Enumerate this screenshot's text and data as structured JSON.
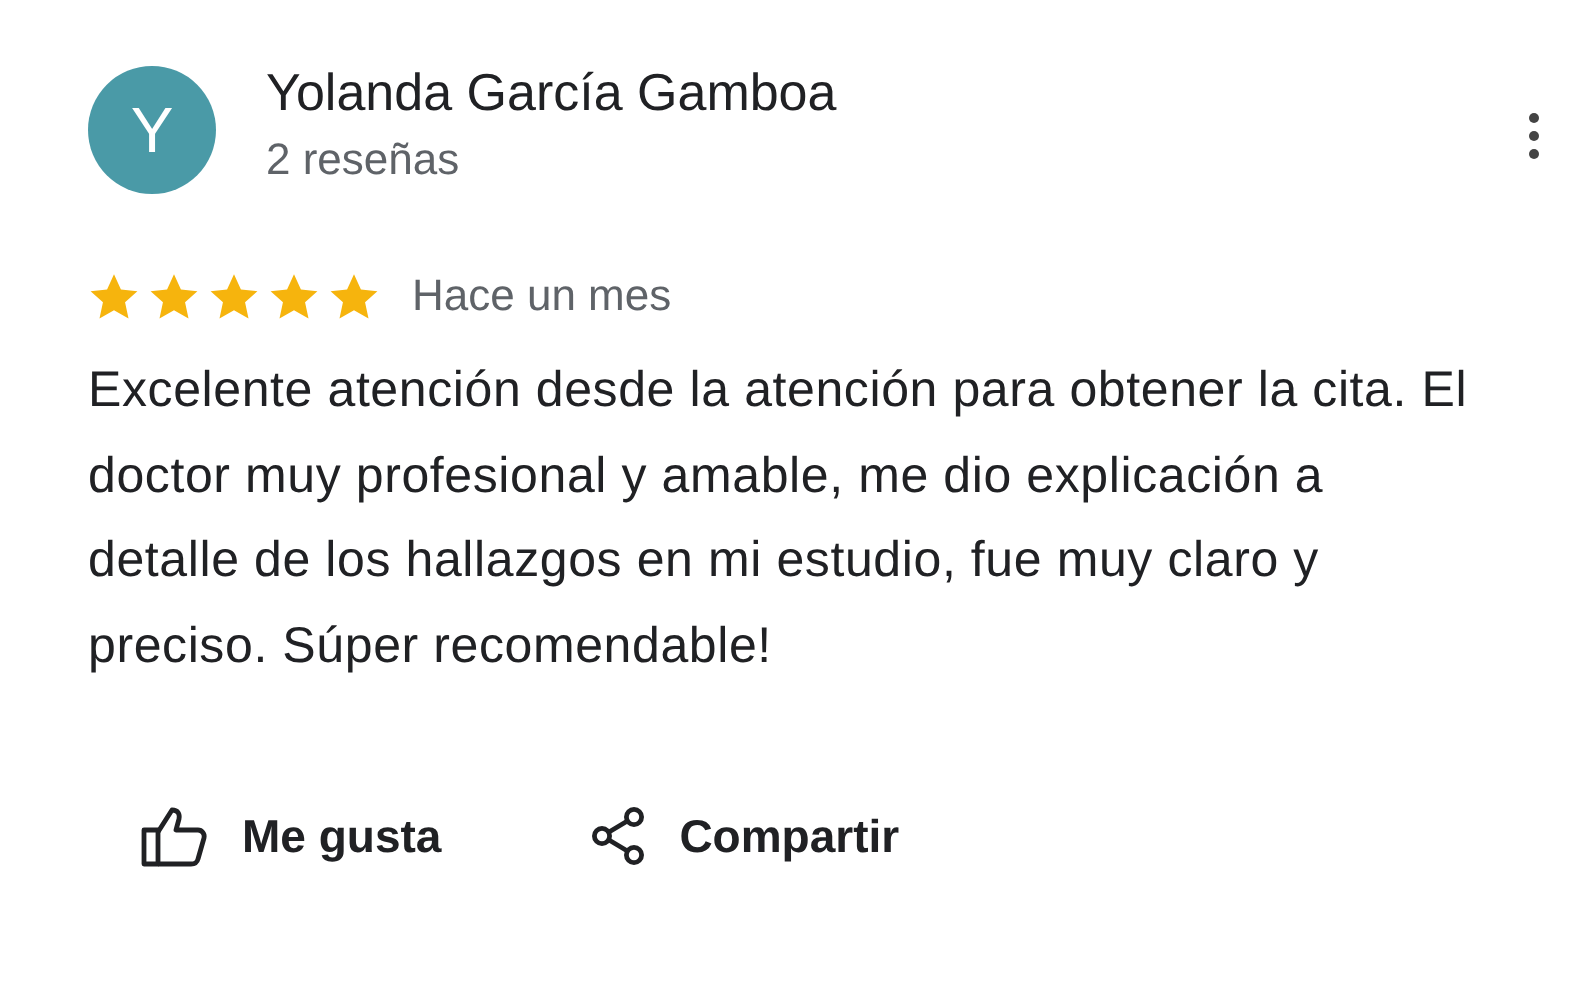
{
  "reviewer": {
    "initial": "Y",
    "color": "#4a9aa7",
    "name": "Yolanda García Gamboa",
    "reviews": "2 reseñas"
  },
  "review": {
    "stars": 5,
    "date": "Hace un mes",
    "text": "Excelente atención desde la atención para obtener la cita. El doctor muy profesional y amable, me dio explicación a detalle de los hallazgos en mi estudio, fue muy claro y preciso. Súper recomendable!"
  },
  "actions": [
    {
      "kind": "like",
      "label": "Me gusta"
    },
    {
      "kind": "share",
      "label": "Compartir"
    }
  ]
}
